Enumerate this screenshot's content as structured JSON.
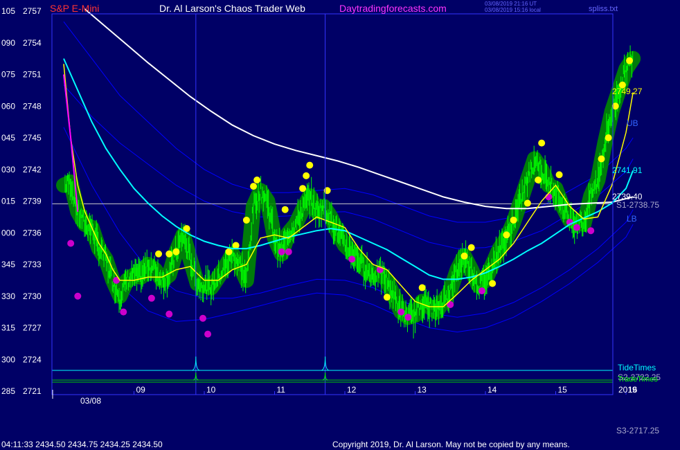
{
  "header": {
    "instrument": "S&P E-Mini",
    "site_title": "Dr. Al Larson's Chaos Trader Web",
    "site_url": "Daytradingforecasts.com",
    "timestamp_utc": "03/08/2019 21:16 UT",
    "timestamp_local": "03/08/2019 15:16 local",
    "file_name": "spliss.txt"
  },
  "colors": {
    "background": "#000066",
    "plot_border": "#3333ff",
    "price_bars": "#00ff00",
    "fast_ma": "#ffff00",
    "mid_ma": "#00ffff",
    "slow_ma": "#ffffff",
    "bands": "#0000ff",
    "pivot_line": "#cccccc",
    "highlight_up": "#ffff00",
    "highlight_down": "#cc00cc",
    "highlight_glow": "#008800"
  },
  "chart_data": {
    "type": "line",
    "title": "S&P E-Mini",
    "ylim": [
      2721,
      2758
    ],
    "y_ticks": [
      {
        "left": "105",
        "price": "2757",
        "value": 2757
      },
      {
        "left": "090",
        "price": "2754",
        "value": 2754
      },
      {
        "left": "075",
        "price": "2751",
        "value": 2751
      },
      {
        "left": "060",
        "price": "2748",
        "value": 2748
      },
      {
        "left": "045",
        "price": "2745",
        "value": 2745
      },
      {
        "left": "030",
        "price": "2742",
        "value": 2742
      },
      {
        "left": "015",
        "price": "2739",
        "value": 2739
      },
      {
        "left": "000",
        "price": "2736",
        "value": 2736
      },
      {
        "left": "345",
        "price": "2733",
        "value": 2733
      },
      {
        "left": "330",
        "price": "2730",
        "value": 2730
      },
      {
        "left": "315",
        "price": "2727",
        "value": 2727
      },
      {
        "left": "300",
        "price": "2724",
        "value": 2724
      },
      {
        "left": "285",
        "price": "2721",
        "value": 2721
      }
    ],
    "xlim": [
      8.0,
      16.1
    ],
    "x_ticks": [
      {
        "label": "09",
        "value": 9
      },
      {
        "label": "10",
        "value": 10
      },
      {
        "label": "11",
        "value": 11
      },
      {
        "label": "12",
        "value": 12
      },
      {
        "label": "13",
        "value": 13
      },
      {
        "label": "14",
        "value": 14
      },
      {
        "label": "15",
        "value": 15
      },
      {
        "label": "16",
        "value": 16
      }
    ],
    "date_label": "03/08",
    "year_label": "2019",
    "vertical_markers": [
      9.88,
      11.72
    ],
    "pivot_line": {
      "value": 2738.75,
      "label": "S1-2738.75"
    },
    "bottom_level_label": "S3-2717.25",
    "band_labels": {
      "upper": "UB",
      "lower": "LB"
    },
    "last_values": {
      "fast_ma": "2749.27",
      "mid_ma": "2741.91",
      "slow_ma": "2739.40"
    },
    "series": [
      {
        "key": "price",
        "x": [
          8.0,
          8.1,
          8.2,
          8.3,
          8.4,
          8.5,
          8.6,
          8.7,
          8.8,
          8.9,
          9.0,
          9.1,
          9.2,
          9.3,
          9.4,
          9.5,
          9.6,
          9.7,
          9.8,
          9.9,
          10.0,
          10.1,
          10.2,
          10.3,
          10.4,
          10.5,
          10.6,
          10.7,
          10.8,
          10.9,
          11.0,
          11.1,
          11.2,
          11.3,
          11.4,
          11.5,
          11.6,
          11.7,
          11.8,
          11.9,
          12.0,
          12.1,
          12.2,
          12.3,
          12.4,
          12.5,
          12.6,
          12.7,
          12.8,
          12.9,
          13.0,
          13.1,
          13.2,
          13.3,
          13.4,
          13.5,
          13.6,
          13.7,
          13.8,
          13.9,
          14.0,
          14.1,
          14.2,
          14.3,
          14.4,
          14.5,
          14.6,
          14.7,
          14.8,
          14.9,
          15.0,
          15.1,
          15.2,
          15.3,
          15.4,
          15.5,
          15.6,
          15.7,
          15.8,
          15.9,
          16.0,
          16.1
        ],
        "values": [
          2740.5,
          2740.8,
          2738,
          2736.8,
          2736.5,
          2734.5,
          2733.5,
          2731.5,
          2730,
          2731.5,
          2732,
          2731.8,
          2733,
          2732.5,
          2731.5,
          2732,
          2734.2,
          2735.8,
          2733.5,
          2731.2,
          2731,
          2730.8,
          2731.8,
          2732.8,
          2734,
          2733,
          2731.5,
          2738.5,
          2740,
          2739,
          2735.5,
          2734,
          2736,
          2736.8,
          2738.2,
          2739.5,
          2738,
          2738.5,
          2737.5,
          2736,
          2734.8,
          2734.2,
          2733.5,
          2732.5,
          2732,
          2732.2,
          2731.5,
          2730,
          2728.5,
          2728,
          2728.2,
          2729.5,
          2729,
          2728.5,
          2729.5,
          2730.5,
          2732.5,
          2733.8,
          2732.5,
          2731,
          2731.5,
          2733,
          2734.5,
          2735.5,
          2737,
          2739,
          2741,
          2743,
          2742,
          2740.5,
          2740.2,
          2738.5,
          2737.2,
          2737,
          2736.8,
          2739.5,
          2741,
          2744.5,
          2747.5,
          2749.5,
          2751.5,
          2752.5
        ]
      },
      {
        "key": "fast_ma",
        "x": [
          8.0,
          8.1,
          8.2,
          8.3,
          8.4,
          8.5,
          8.6,
          8.7,
          8.8,
          8.9,
          9.0,
          9.2,
          9.4,
          9.6,
          9.8,
          10.0,
          10.2,
          10.4,
          10.6,
          10.8,
          11.0,
          11.2,
          11.4,
          11.6,
          11.8,
          12.0,
          12.2,
          12.4,
          12.6,
          12.8,
          13.0,
          13.2,
          13.4,
          13.6,
          13.8,
          14.0,
          14.2,
          14.4,
          14.6,
          14.8,
          15.0,
          15.2,
          15.4,
          15.6,
          15.8,
          16.0,
          16.1
        ],
        "values": [
          2752,
          2745,
          2740.5,
          2738,
          2736.5,
          2735,
          2734,
          2732.5,
          2731.5,
          2731.5,
          2731.5,
          2731.8,
          2731.8,
          2732.5,
          2732.8,
          2731.5,
          2731.5,
          2732.5,
          2733,
          2735.5,
          2735.8,
          2735.5,
          2736.5,
          2737.5,
          2737,
          2736.5,
          2734.5,
          2733,
          2732.5,
          2731,
          2729.5,
          2729,
          2729,
          2730.2,
          2731.5,
          2732.5,
          2733.5,
          2735,
          2737,
          2739,
          2740.5,
          2738.5,
          2737.3,
          2737.5,
          2740.5,
          2745.5,
          2749.3
        ]
      },
      {
        "key": "mid_ma",
        "x": [
          8.0,
          8.2,
          8.4,
          8.6,
          8.8,
          9.0,
          9.2,
          9.4,
          9.6,
          9.8,
          10.0,
          10.2,
          10.4,
          10.6,
          10.8,
          11.0,
          11.2,
          11.4,
          11.6,
          11.8,
          12.0,
          12.2,
          12.4,
          12.6,
          12.8,
          13.0,
          13.2,
          13.4,
          13.6,
          13.8,
          14.0,
          14.2,
          14.4,
          14.6,
          14.8,
          15.0,
          15.2,
          15.4,
          15.6,
          15.8,
          16.0,
          16.1
        ],
        "values": [
          2752.5,
          2749.5,
          2746.5,
          2744,
          2742,
          2740.2,
          2738.8,
          2737.6,
          2736.6,
          2735.8,
          2735.2,
          2734.8,
          2734.5,
          2734.5,
          2734.8,
          2735.2,
          2735.6,
          2735.9,
          2736.2,
          2736.4,
          2736.2,
          2735.6,
          2735,
          2734.4,
          2733.6,
          2732.8,
          2732,
          2731.6,
          2731.6,
          2731.8,
          2732.2,
          2732.8,
          2733.5,
          2734.3,
          2735,
          2735.9,
          2736.8,
          2737.4,
          2738,
          2738.8,
          2740.2,
          2741.9
        ]
      },
      {
        "key": "slow_ma",
        "x": [
          8.3,
          8.6,
          8.9,
          9.2,
          9.5,
          9.8,
          10.1,
          10.4,
          10.7,
          11.0,
          11.3,
          11.6,
          11.9,
          12.2,
          12.5,
          12.8,
          13.1,
          13.4,
          13.7,
          14.0,
          14.3,
          14.6,
          14.9,
          15.2,
          15.5,
          15.8,
          16.1
        ],
        "values": [
          2757.2,
          2755.5,
          2753.8,
          2752.1,
          2750.5,
          2748.9,
          2747.5,
          2746.2,
          2745.2,
          2744.4,
          2743.8,
          2743.3,
          2742.8,
          2742.2,
          2741.5,
          2740.8,
          2740.1,
          2739.4,
          2738.9,
          2738.5,
          2738.3,
          2738.3,
          2738.5,
          2738.7,
          2738.8,
          2738.9,
          2739.4
        ]
      },
      {
        "key": "upper_band",
        "x": [
          8.0,
          8.4,
          8.8,
          9.2,
          9.6,
          10.0,
          10.4,
          10.8,
          11.2,
          11.6,
          12.0,
          12.4,
          12.8,
          13.2,
          13.6,
          14.0,
          14.4,
          14.8,
          15.2,
          15.6,
          16.0,
          16.1
        ],
        "values": [
          2756,
          2752.5,
          2749,
          2746.5,
          2744,
          2742,
          2740.6,
          2739.8,
          2739.8,
          2740,
          2740.2,
          2739.6,
          2738.6,
          2737.6,
          2737,
          2737,
          2737.5,
          2738.5,
          2740,
          2741.5,
          2744,
          2745
        ]
      },
      {
        "key": "upper_band_2",
        "x": [
          8.0,
          8.4,
          8.8,
          9.2,
          9.6,
          10.0,
          10.4,
          10.8,
          11.2,
          11.6,
          12.0,
          12.4,
          12.8,
          13.2,
          13.6,
          14.0,
          14.4,
          14.8,
          15.2,
          15.6,
          16.0,
          16.1
        ],
        "values": [
          2750,
          2747,
          2744.5,
          2742.5,
          2740.5,
          2739,
          2738,
          2737.5,
          2737.6,
          2737.9,
          2738,
          2737.3,
          2736.2,
          2735.1,
          2734.5,
          2734.6,
          2735.2,
          2736.2,
          2737.8,
          2739.5,
          2741.8,
          2743
        ]
      },
      {
        "key": "lower_band_2",
        "x": [
          8.0,
          8.4,
          8.8,
          9.2,
          9.6,
          10.0,
          10.4,
          10.8,
          11.2,
          11.6,
          12.0,
          12.4,
          12.8,
          13.2,
          13.6,
          14.0,
          14.4,
          14.8,
          15.2,
          15.6,
          16.0,
          16.1
        ],
        "values": [
          2746,
          2740.5,
          2736,
          2732.5,
          2730.5,
          2729.8,
          2729.8,
          2730.3,
          2731,
          2731.6,
          2731.5,
          2730.8,
          2729.6,
          2728.4,
          2728,
          2728.4,
          2729.4,
          2730.8,
          2732.5,
          2734.5,
          2737,
          2738.2
        ]
      },
      {
        "key": "lower_band",
        "x": [
          8.0,
          8.4,
          8.8,
          9.2,
          9.6,
          10.0,
          10.4,
          10.8,
          11.2,
          11.6,
          12.0,
          12.4,
          12.8,
          13.2,
          13.6,
          14.0,
          14.4,
          14.8,
          15.2,
          15.6,
          16.0,
          16.1
        ],
        "values": [
          2741,
          2735,
          2731,
          2728.6,
          2727.6,
          2727.8,
          2728.4,
          2729.1,
          2729.8,
          2730.3,
          2730.1,
          2729.2,
          2728,
          2727,
          2726.6,
          2727,
          2728,
          2729.5,
          2731.2,
          2733.2,
          2735.6,
          2736.8
        ]
      }
    ],
    "highlights_up": [
      {
        "x": 9.35,
        "y": 2734
      },
      {
        "x": 9.5,
        "y": 2734
      },
      {
        "x": 9.6,
        "y": 2734.2
      },
      {
        "x": 9.75,
        "y": 2736.4
      },
      {
        "x": 10.35,
        "y": 2734.2
      },
      {
        "x": 10.45,
        "y": 2734.8
      },
      {
        "x": 10.6,
        "y": 2737.2
      },
      {
        "x": 10.7,
        "y": 2740.4
      },
      {
        "x": 10.75,
        "y": 2741
      },
      {
        "x": 11.15,
        "y": 2738.2
      },
      {
        "x": 11.4,
        "y": 2740.2
      },
      {
        "x": 11.45,
        "y": 2741.4
      },
      {
        "x": 11.5,
        "y": 2742.4
      },
      {
        "x": 11.75,
        "y": 2740
      },
      {
        "x": 12.6,
        "y": 2729.9
      },
      {
        "x": 13.1,
        "y": 2730.8
      },
      {
        "x": 13.7,
        "y": 2733.8
      },
      {
        "x": 13.8,
        "y": 2734.6
      },
      {
        "x": 14.1,
        "y": 2731.2
      },
      {
        "x": 14.3,
        "y": 2735.8
      },
      {
        "x": 14.4,
        "y": 2737.2
      },
      {
        "x": 14.6,
        "y": 2738.8
      },
      {
        "x": 14.8,
        "y": 2744.5
      },
      {
        "x": 14.75,
        "y": 2741
      },
      {
        "x": 15.05,
        "y": 2741.5
      },
      {
        "x": 15.65,
        "y": 2743
      },
      {
        "x": 15.75,
        "y": 2745
      },
      {
        "x": 15.85,
        "y": 2748
      },
      {
        "x": 15.95,
        "y": 2750
      },
      {
        "x": 16.05,
        "y": 2752.3
      }
    ],
    "highlights_down": [
      {
        "x": 8.1,
        "y": 2735
      },
      {
        "x": 8.2,
        "y": 2730
      },
      {
        "x": 8.75,
        "y": 2731.5
      },
      {
        "x": 8.85,
        "y": 2728.5
      },
      {
        "x": 9.25,
        "y": 2729.8
      },
      {
        "x": 9.5,
        "y": 2728.3
      },
      {
        "x": 9.98,
        "y": 2727.9
      },
      {
        "x": 10.05,
        "y": 2726.4
      },
      {
        "x": 11.1,
        "y": 2734.2
      },
      {
        "x": 11.2,
        "y": 2734.2
      },
      {
        "x": 12.1,
        "y": 2733.5
      },
      {
        "x": 12.5,
        "y": 2732.5
      },
      {
        "x": 12.8,
        "y": 2728.5
      },
      {
        "x": 12.9,
        "y": 2728
      },
      {
        "x": 13.5,
        "y": 2729.2
      },
      {
        "x": 13.95,
        "y": 2730.5
      },
      {
        "x": 14.9,
        "y": 2739.4
      },
      {
        "x": 15.2,
        "y": 2737
      },
      {
        "x": 15.3,
        "y": 2736.5
      },
      {
        "x": 15.5,
        "y": 2736.2
      }
    ]
  },
  "timing": {
    "tide_label": "TideTimes",
    "trade_label": "TradeTimes",
    "s2_label": "S2-2722.25"
  },
  "footer": {
    "quote": "04:11:33  2434.50  2434.75  2434.25  2434.50",
    "copyright": "Copyright 2019, Dr. Al Larson. May not be copied by any means."
  }
}
